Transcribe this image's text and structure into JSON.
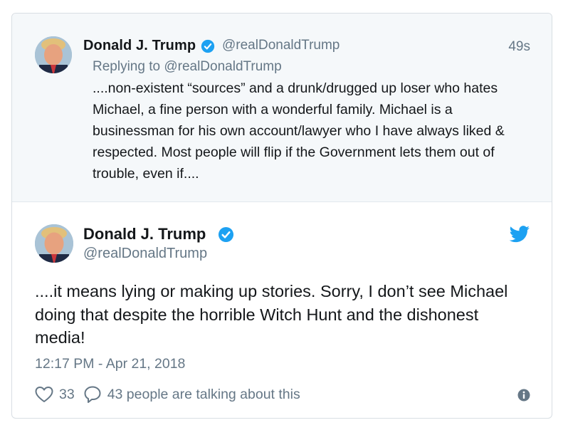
{
  "colors": {
    "accent": "#1da1f2",
    "text": "#14171a",
    "muted": "#657786",
    "reply_bg": "#f5f8fa",
    "border": "#d8dee3"
  },
  "reply_tweet": {
    "author_name": "Donald J. Trump",
    "handle": "@realDonaldTrump",
    "time": "49s",
    "replying_to": "Replying to @realDonaldTrump",
    "text": "....non-existent “sources” and a drunk/drugged up loser who hates Michael, a fine person with a wonderful family. Michael is a businessman for his own account/lawyer who I have always liked & respected. Most people will flip if the Government lets them out of trouble, even if....",
    "avatar_icon": "avatar",
    "verified_icon": "verified-badge-icon"
  },
  "main_tweet": {
    "author_name": "Donald J. Trump",
    "handle": "@realDonaldTrump",
    "text": "....it means lying or making up stories. Sorry, I don’t see Michael doing that despite the horrible Witch Hunt and the dishonest media!",
    "timestamp": "12:17 PM - Apr 21, 2018",
    "likes": "33",
    "talking": "43 people are talking about this",
    "icons": [
      "twitter-bird-icon",
      "heart-icon",
      "comment-bubble-icon",
      "info-icon"
    ]
  }
}
